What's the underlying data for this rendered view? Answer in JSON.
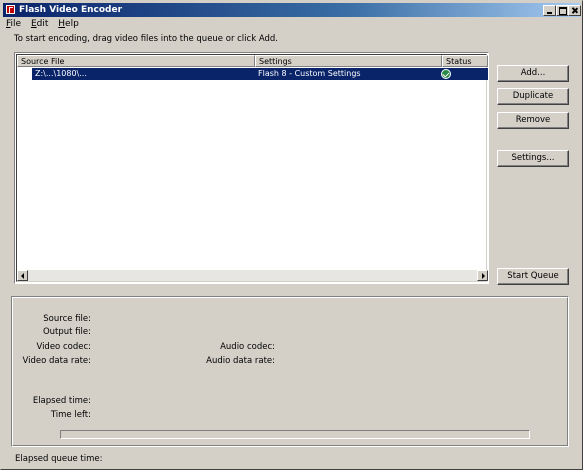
{
  "window": {
    "title": "Flash Video Encoder"
  },
  "menu": {
    "items": [
      "File",
      "Edit",
      "Help"
    ]
  },
  "instruction": "To start encoding, drag video files into the queue or click Add.",
  "queue": {
    "columns": [
      "Source File",
      "Settings",
      "Status"
    ],
    "rows": [
      {
        "source": "Z:\\...\\1080\\...",
        "settings": "Flash 8 - Custom Settings",
        "status_icon": "check-circle-icon",
        "selected": true
      }
    ]
  },
  "buttons": {
    "add": "Add...",
    "duplicate": "Duplicate",
    "remove": "Remove",
    "settings": "Settings...",
    "start_queue": "Start Queue"
  },
  "details": {
    "source_file": "Source file:",
    "output_file": "Output file:",
    "video_codec": "Video codec:",
    "audio_codec": "Audio codec:",
    "video_data_rate": "Video data rate:",
    "audio_data_rate": "Audio data rate:",
    "elapsed_time": "Elapsed time:",
    "time_left": "Time left:",
    "progress": 0
  },
  "footer": {
    "elapsed_queue_time": "Elapsed queue time:"
  },
  "colors": {
    "titlebar": "#0a246a",
    "selection": "#0a246a",
    "status_ok": "#2a8a4a"
  }
}
